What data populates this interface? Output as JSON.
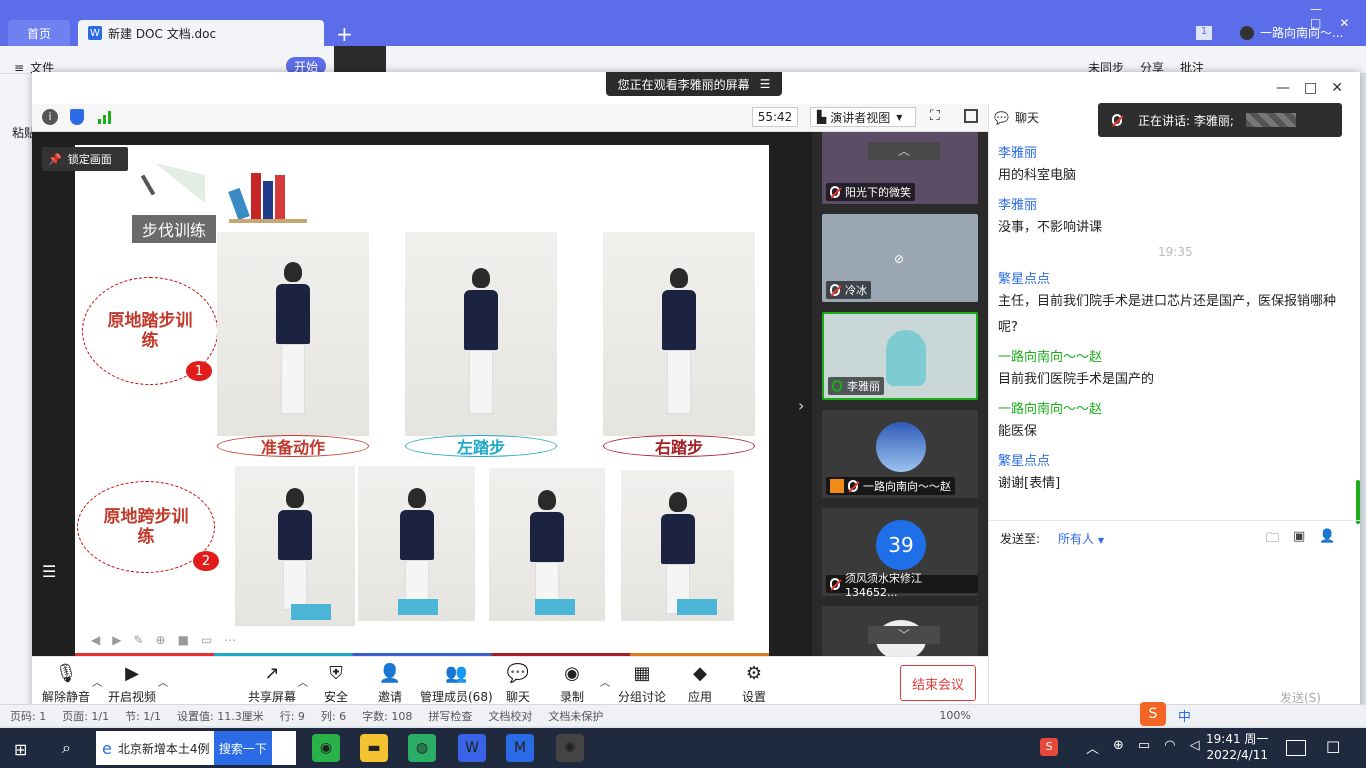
{
  "wps": {
    "tab_home": "首页",
    "tab_doc": "新建 DOC 文档.doc",
    "menu_file": "文件",
    "menu_start": "开始",
    "menu_sync": "未同步",
    "menu_share": "分享",
    "menu_annotate": "批注",
    "ribbon_paste": "粘贴",
    "user": "一路向南向～...",
    "status": {
      "page": "页码: 1",
      "pages": "页面: 1/1",
      "section": "节: 1/1",
      "setting": "设置值: 11.3厘米",
      "row": "行: 9",
      "col": "列: 6",
      "words": "字数: 108",
      "spell": "拼写检查",
      "proof": "文档校对",
      "protect": "文档未保护",
      "zoom": "100%"
    }
  },
  "meeting": {
    "banner": "您正在观看李雅丽的屏幕",
    "timer": "55:42",
    "view_mode": "演讲者视图",
    "lock_screen": "锁定画面",
    "chat_title": "聊天",
    "speaking": "正在讲话: 李雅丽;",
    "slide": {
      "heading": "步伐训练",
      "section1": "原地踏步训练",
      "section2": "原地跨步训练",
      "badge1": "1",
      "badge2": "2",
      "cap1": "准备动作",
      "cap2": "左踏步",
      "cap3": "右踏步"
    },
    "participants": [
      {
        "name": "阳光下的微笑"
      },
      {
        "name": "冷冰"
      },
      {
        "name": "李雅丽"
      },
      {
        "name": "一路向南向～～赵"
      },
      {
        "name": "须风须水宋修江134652..."
      }
    ],
    "avatar_number": "39",
    "toolbar": {
      "unmute": "解除静音",
      "video": "开启视频",
      "share": "共享屏幕",
      "security": "安全",
      "invite": "邀请",
      "manage": "管理成员(68)",
      "chat": "聊天",
      "record": "录制",
      "breakout": "分组讨论",
      "apps": "应用",
      "settings": "设置",
      "end": "结束会议"
    },
    "chat": {
      "messages": [
        {
          "sender": "李雅丽",
          "text": "用的科室电脑"
        },
        {
          "sender": "李雅丽",
          "text": "没事，不影响讲课"
        },
        {
          "time": "19:35"
        },
        {
          "sender": "繁星点点",
          "text": "主任，目前我们院手术是进口芯片还是国产，医保报销哪种呢?"
        },
        {
          "sender": "一路向南向～～赵",
          "text": "目前我们医院手术是国产的"
        },
        {
          "sender": "一路向南向～～赵",
          "text": "能医保"
        },
        {
          "sender": "繁星点点",
          "text": "谢谢[表情]"
        }
      ],
      "send_to_label": "发送至:",
      "send_to_value": "所有人",
      "send_button": "发送(S)"
    }
  },
  "taskbar": {
    "search_text": "北京新增本土4例",
    "search_button": "搜索一下",
    "ime": "中",
    "time": "19:41 周一",
    "date": "2022/4/11"
  },
  "colors": {
    "accent": "#2b6ce6",
    "wps_bar": "#5b6de8",
    "end_red": "#e33b3b",
    "chat_green": "#1aad19"
  }
}
